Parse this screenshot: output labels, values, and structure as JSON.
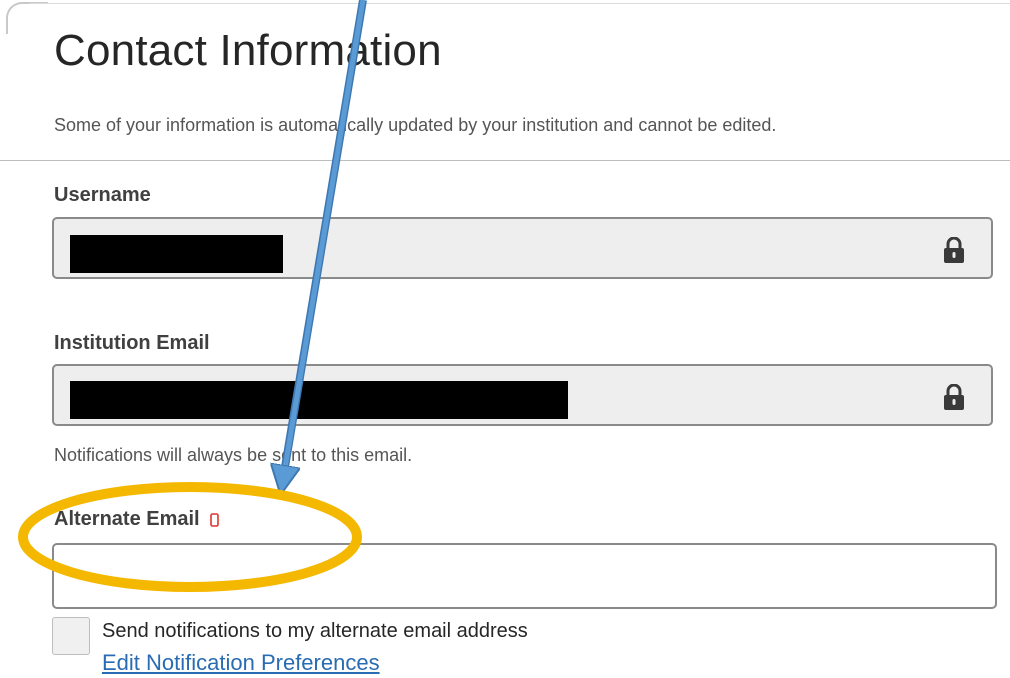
{
  "page": {
    "title": "Contact Information",
    "subtitle": "Some of your information is automatically updated by your institution and cannot be edited."
  },
  "fields": {
    "username": {
      "label": "Username",
      "value_redacted": true,
      "locked": true,
      "icon": "lock-icon"
    },
    "institution_email": {
      "label": "Institution Email",
      "value_redacted": true,
      "locked": true,
      "icon": "lock-icon",
      "help_text": "Notifications will always be sent to this email."
    },
    "alternate_email": {
      "label": "Alternate Email",
      "icon": "mobile-icon",
      "value": "",
      "placeholder": ""
    }
  },
  "notifications": {
    "checkbox_label": "Send notifications to my alternate email address",
    "checked": false,
    "link_label": "Edit Notification Preferences"
  },
  "annotations": {
    "arrow_color": "#5b9bd5",
    "highlight_color": "#f5b800"
  },
  "colors": {
    "link": "#2a6cb3",
    "field_border": "#8a8a8a",
    "locked_field_bg": "#eeeeee",
    "mobile_icon": "#e0332b"
  }
}
